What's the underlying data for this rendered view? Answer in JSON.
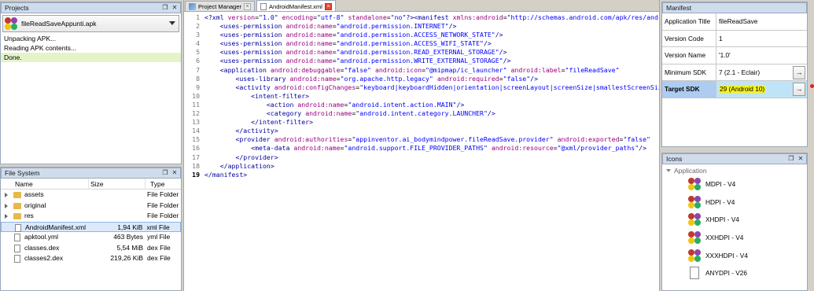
{
  "projects_panel": {
    "title": "Projects",
    "selected_project": "fileReadSaveAppunti.apk",
    "log": [
      "Unpacking APK...",
      "Reading APK contents...",
      "Done."
    ]
  },
  "filesystem_panel": {
    "title": "File System",
    "columns": [
      "Name",
      "Size",
      "Type"
    ],
    "rows": [
      {
        "name": "assets",
        "size": "",
        "type": "File Folder",
        "kind": "folder"
      },
      {
        "name": "original",
        "size": "",
        "type": "File Folder",
        "kind": "folder"
      },
      {
        "name": "res",
        "size": "",
        "type": "File Folder",
        "kind": "folder"
      },
      {
        "name": "AndroidManifest.xml",
        "size": "1,94 KiB",
        "type": "xml File",
        "kind": "file"
      },
      {
        "name": "apktool.yml",
        "size": "463 Bytes",
        "type": "yml File",
        "kind": "file"
      },
      {
        "name": "classes.dex",
        "size": "5,54 MiB",
        "type": "dex File",
        "kind": "file"
      },
      {
        "name": "classes2.dex",
        "size": "219,26 KiB",
        "type": "dex File",
        "kind": "file"
      }
    ]
  },
  "editor": {
    "tabs": [
      "Project Manager",
      "AndroidManifest.xml"
    ],
    "active_tab": "AndroidManifest.xml",
    "lines": [
      "<?xml version=\"1.0\" encoding=\"utf-8\" standalone=\"no\"?><manifest xmlns:android=\"http://schemas.android.com/apk/res/android\"",
      "    <uses-permission android:name=\"android.permission.INTERNET\"/>",
      "    <uses-permission android:name=\"android.permission.ACCESS_NETWORK_STATE\"/>",
      "    <uses-permission android:name=\"android.permission.ACCESS_WIFI_STATE\"/>",
      "    <uses-permission android:name=\"android.permission.READ_EXTERNAL_STORAGE\"/>",
      "    <uses-permission android:name=\"android.permission.WRITE_EXTERNAL_STORAGE\"/>",
      "    <application android:debuggable=\"false\" android:icon=\"@mipmap/ic_launcher\" android:label=\"fileReadSave\"",
      "        <uses-library android:name=\"org.apache.http.legacy\" android:required=\"false\"/>",
      "        <activity android:configChanges=\"keyboard|keyboardHidden|orientation|screenLayout|screenSize|smallestScreenSize\"",
      "            <intent-filter>",
      "                <action android:name=\"android.intent.action.MAIN\"/>",
      "                <category android:name=\"android.intent.category.LAUNCHER\"/>",
      "            </intent-filter>",
      "        </activity>",
      "        <provider android:authorities=\"appinventor.ai_bodymindpower.fileReadSave.provider\" android:exported=\"false\"",
      "            <meta-data android:name=\"android.support.FILE_PROVIDER_PATHS\" android:resource=\"@xml/provider_paths\"/>",
      "        </provider>",
      "    </application>",
      "</manifest>"
    ],
    "current_line": 19
  },
  "manifest_panel": {
    "title": "Manifest",
    "props": [
      {
        "label": "Application Title",
        "value": "fileReadSave"
      },
      {
        "label": "Version Code",
        "value": "1"
      },
      {
        "label": "Version Name",
        "value": "'1.0'"
      },
      {
        "label": "Minimum SDK",
        "value": "7 (2.1 - Eclair)"
      },
      {
        "label": "Target SDK",
        "value": "29 (Android 10)"
      }
    ]
  },
  "icons_panel": {
    "title": "Icons",
    "root": "Application",
    "items": [
      "MDPI - V4",
      "HDPI - V4",
      "XHDPI - V4",
      "XXHDPI - V4",
      "XXXHDPI - V4",
      "ANYDPI - V26"
    ]
  }
}
